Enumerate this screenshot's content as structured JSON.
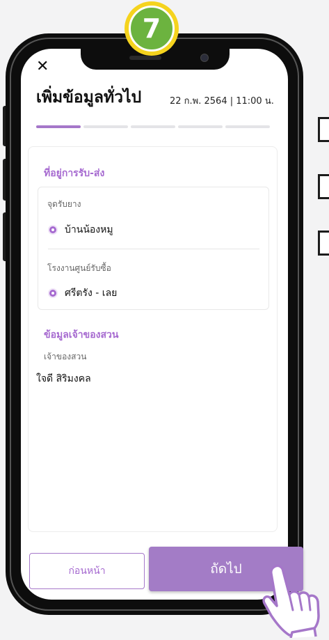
{
  "step_badge": {
    "number": "7"
  },
  "header": {
    "close_icon": "close-icon",
    "title": "เพิ่มข้อมูลทั่วไป",
    "datetime": "22 ก.พ. 2564  | 11:00 น."
  },
  "progress": {
    "total_steps": 5,
    "current_step": 1
  },
  "delivery": {
    "section_title": "ที่อยู่การรับ-ส่ง",
    "pickup_label": "จุดรับยาง",
    "pickup_value": "บ้านน้องหมู",
    "factory_label": "โรงงานศูนย์รับซื้อ",
    "factory_value": "ศรีตรัง - เลย"
  },
  "owner": {
    "section_title": "ข้อมูลเจ้าของสวน",
    "label": "เจ้าของสวน",
    "name": "ใจดี สิริมงคล"
  },
  "footer": {
    "back_label": "ก่อนหน้า",
    "next_label": "ถัดไป"
  },
  "colors": {
    "accent": "#a66ad0",
    "button": "#a37cc6",
    "badge_outer": "#f5d31e",
    "badge_inner": "#6cb33f"
  }
}
